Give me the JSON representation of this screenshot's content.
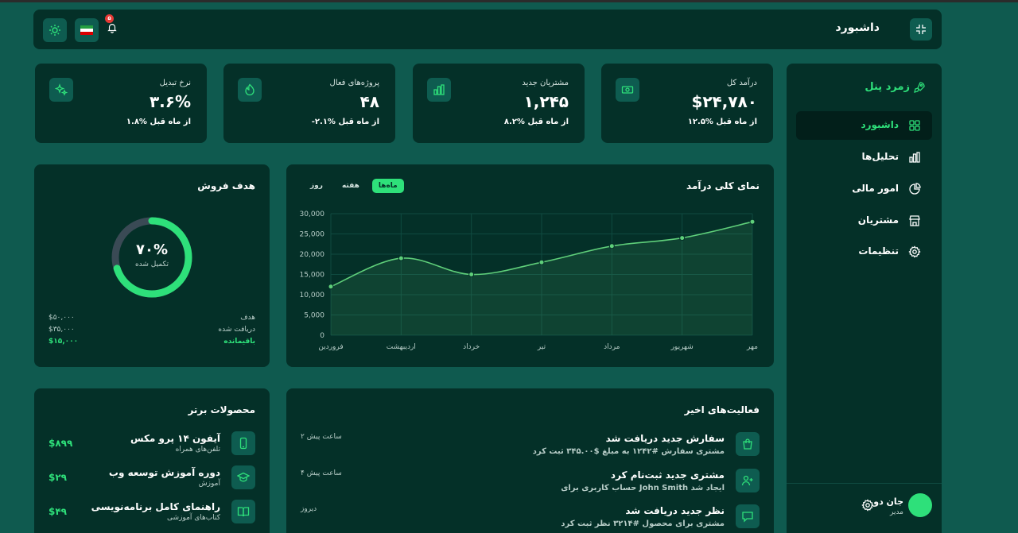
{
  "header": {
    "title": "داشبورد",
    "notification_count": "۵"
  },
  "sidebar": {
    "brand": "زمرد پنل",
    "items": [
      {
        "label": "داشبورد",
        "active": true
      },
      {
        "label": "تحلیل‌ها",
        "active": false
      },
      {
        "label": "امور مالی",
        "active": false
      },
      {
        "label": "مشتریان",
        "active": false
      },
      {
        "label": "تنظیمات",
        "active": false
      }
    ],
    "user": {
      "name": "جان دو",
      "role": "مدیر"
    }
  },
  "stats": [
    {
      "label": "درآمد کل",
      "value": "$۲۴,۷۸۰",
      "change": "۱۲.۵% از ماه قبل"
    },
    {
      "label": "مشتریان جدید",
      "value": "۱,۲۴۵",
      "change": "۸.۲% از ماه قبل"
    },
    {
      "label": "پروژه‌های فعال",
      "value": "۴۸",
      "change": "-۲.۱% از ماه قبل"
    },
    {
      "label": "نرخ تبدیل",
      "value": "۳.۶%",
      "change": "۱.۸% از ماه قبل"
    }
  ],
  "revenue": {
    "title": "نمای کلی درآمد",
    "tabs": [
      "ماه‌ها",
      "هفته",
      "روز"
    ],
    "active_tab": "ماه‌ها"
  },
  "chart_data": {
    "type": "area",
    "categories": [
      "فروردین",
      "اردیبهشت",
      "خرداد",
      "تیر",
      "مرداد",
      "شهریور",
      "مهر"
    ],
    "values": [
      12000,
      19000,
      15000,
      18000,
      22000,
      24000,
      28000
    ],
    "yticks": [
      "0",
      "5,000",
      "10,000",
      "15,000",
      "20,000",
      "25,000",
      "30,000"
    ],
    "ylim": [
      0,
      30000
    ],
    "grid": true,
    "color": "#5fcf7a"
  },
  "goal": {
    "title": "هدف فروش",
    "percent": 70,
    "percent_label": "۷۰%",
    "sub_label": "تکمیل شده",
    "rows": [
      {
        "key": "هدف",
        "value": "$۵۰,۰۰۰"
      },
      {
        "key": "دریافت شده",
        "value": "$۳۵,۰۰۰"
      },
      {
        "key": "باقیمانده",
        "value": "$۱۵,۰۰۰"
      }
    ]
  },
  "activities": {
    "title": "فعالیت‌های اخیر",
    "items": [
      {
        "title": "سفارش جدید دریافت شد",
        "desc": "مشتری سفارش #۱۲۴۲ به مبلغ $۳۴۵.۰۰ ثبت کرد",
        "time": "۲ ساعت پیش"
      },
      {
        "title": "مشتری جدید ثبت‌نام کرد",
        "desc": "حساب کاربری برای John Smith ایجاد شد",
        "time": "۴ ساعت پیش"
      },
      {
        "title": "نظر جدید دریافت شد",
        "desc": "مشتری برای محصول #۳۲۱۴ نظر ثبت کرد",
        "time": "دیروز"
      }
    ]
  },
  "products": {
    "title": "محصولات برتر",
    "items": [
      {
        "name": "آیفون ۱۴ پرو مکس",
        "category": "تلفن‌های همراه",
        "price": "$۸۹۹"
      },
      {
        "name": "دوره آموزش توسعه وب",
        "category": "آموزش",
        "price": "$۲۹"
      },
      {
        "name": "راهنمای کامل برنامه‌نویسی",
        "category": "کتاب‌های آموزشی",
        "price": "$۴۹"
      }
    ]
  },
  "colors": {
    "accent": "#2ee07a",
    "panel": "#043028",
    "background": "#0f5a4f"
  }
}
